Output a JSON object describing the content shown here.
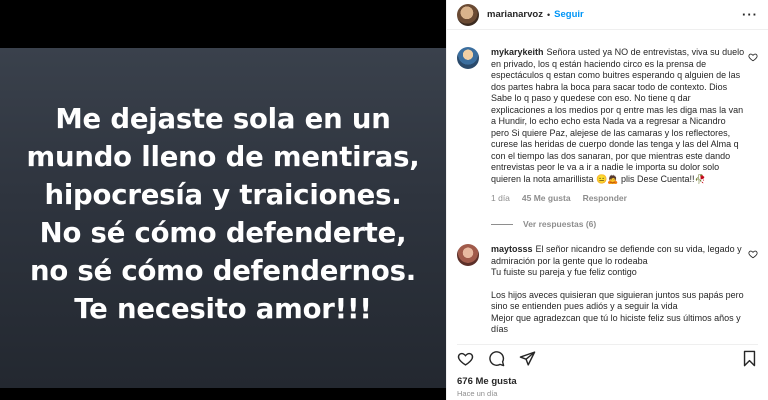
{
  "post": {
    "quote": "Me dejaste sola en un\nmundo lleno de mentiras,\nhipocresía y traiciones.\nNo sé cómo defenderte,\nno sé cómo defendernos.\nTe necesito amor!!!"
  },
  "header": {
    "username": "marianarvoz",
    "separator": "•",
    "follow_label": "Seguir",
    "more": "···"
  },
  "comments": [
    {
      "username": "mykarykeith",
      "text": "Señora usted ya NO de entrevistas, viva su duelo en privado, los q están haciendo circo es la prensa de espectáculos q estan como buitres esperando q alguien de las dos partes habra la boca para sacar todo de contexto. Dios Sabe lo q paso y quedese con eso. No tiene q dar explicaciones a los medios por q entre mas les diga mas la van a Hundir, lo echo echo esta Nada va a regresar a Nicandro pero Si quiere Paz, alejese de las camaras y los reflectores, curese las heridas de cuerpo donde las tenga y las del Alma q con el tiempo las dos sanaran, por que mientras este dando entrevistas peor le va a ir a nadie le importa su dolor solo quieren la nota amarillista 😑🙇 plis Dese Cuenta!!🥀",
      "age": "1 día",
      "likes": "45 Me gusta",
      "reply_label": "Responder",
      "view_replies": "Ver respuestas (6)"
    },
    {
      "username": "maytosss",
      "text": "El señor nicandro se defiende con su vida, legado y admiración por la gente que lo rodeaba\nTu fuiste su pareja y fue feliz contigo",
      "text2": "Los hijos aveces quisieran que siguieran juntos sus papás pero sino se entienden pues adiós y a seguir la vida\nMejor que agradezcan que tú lo hiciste feliz sus últimos años y días"
    }
  ],
  "footer": {
    "likes": "676 Me gusta",
    "time": "Hace un día"
  },
  "colors": {
    "accent": "#0095f6",
    "secondary_text": "#8e8e8e",
    "image_bg": "#2e343e"
  },
  "icons": [
    "heart-icon",
    "comment-icon",
    "share-icon",
    "bookmark-icon",
    "more-icon"
  ]
}
